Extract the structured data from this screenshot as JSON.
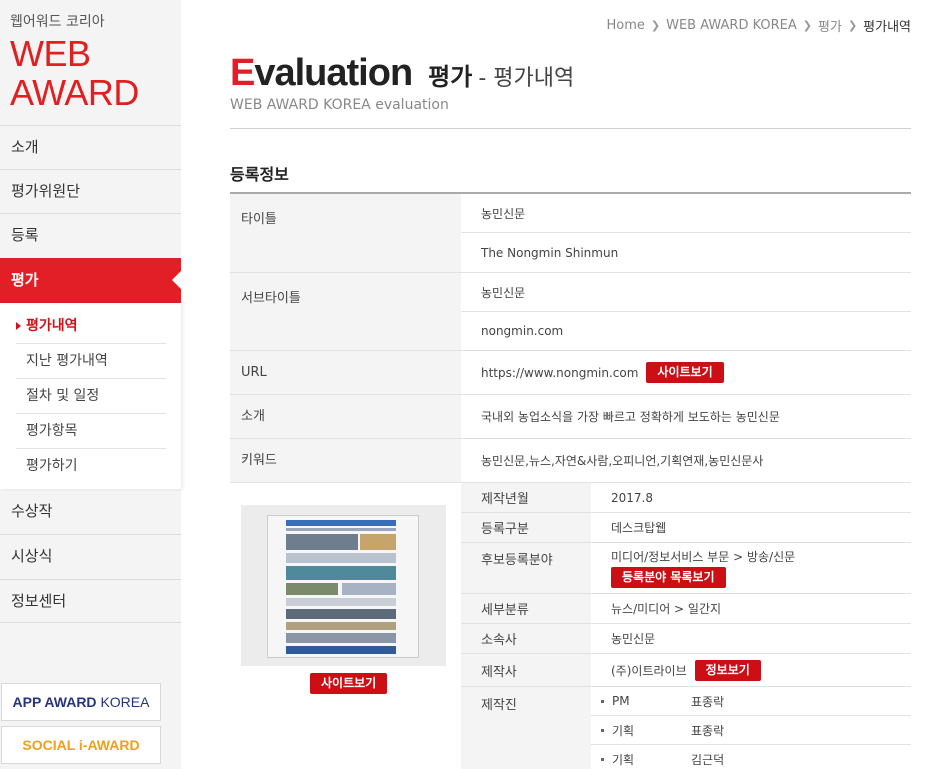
{
  "sidebar": {
    "brand_top": "웹어워드 코리아",
    "brand_web": "WEB",
    "brand_award": "AWARD",
    "nav": [
      "소개",
      "평가위원단",
      "등록",
      "평가",
      "수상작",
      "시상식",
      "정보센터"
    ],
    "subnav": [
      "평가내역",
      "지난 평가내역",
      "절차 및 일정",
      "평가항목",
      "평가하기"
    ],
    "app_award_bold": "APP AWARD",
    "app_award_light": "KOREA",
    "social_award": "SOCIAL i-AWARD"
  },
  "breadcrumb": [
    "Home",
    "WEB AWARD KOREA",
    "평가",
    "평가내역"
  ],
  "title": {
    "en_first": "E",
    "en_rest": "valuation",
    "ko": "평가",
    "sub": "- 평가내역",
    "subtitle": "WEB AWARD KOREA evaluation"
  },
  "section_title": "등록정보",
  "labels": {
    "title": "타이틀",
    "subtitle": "서브타이틀",
    "url": "URL",
    "intro": "소개",
    "keyword": "키워드"
  },
  "values": {
    "title_ko": "농민신문",
    "title_en": "The Nongmin Shinmun",
    "subtitle_1": "농민신문",
    "subtitle_2": "nongmin.com",
    "url": "https://www.nongmin.com",
    "intro": "국내외 농업소식을 가장 빠르고 정확하게 보도하는 농민신문",
    "keyword": "농민신문,뉴스,자연&사람,오피니언,기획연재,농민신문사"
  },
  "buttons": {
    "site_view": "사이트보기",
    "category_list": "등록분야 목록보기",
    "info_view": "정보보기"
  },
  "details": {
    "year_label": "제작년월",
    "year": "2017.8",
    "type_label": "등록구분",
    "type": "데스크탑웹",
    "category_label": "후보등록분야",
    "category": "미디어/정보서비스 부문 > 방송/신문",
    "subcat_label": "세부분류",
    "subcat": "뉴스/미디어 > 일간지",
    "owner_label": "소속사",
    "owner": "농민신문",
    "maker_label": "제작사",
    "maker": "(주)이트라이브",
    "crew_label": "제작진",
    "crew": [
      {
        "role": "PM",
        "name": "표종락"
      },
      {
        "role": "기획",
        "name": "표종락"
      },
      {
        "role": "기획",
        "name": "김근덕"
      }
    ]
  }
}
